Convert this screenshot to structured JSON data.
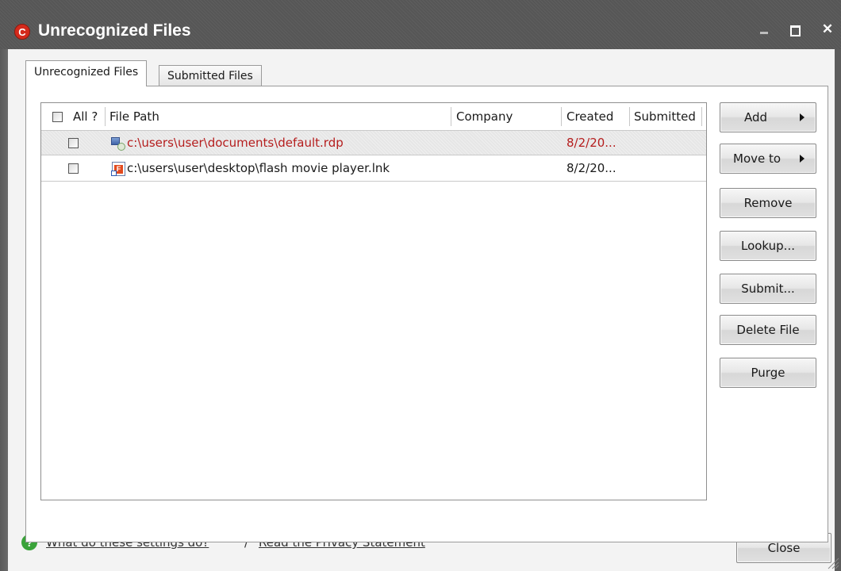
{
  "window": {
    "title": "Unrecognized Files",
    "app_icon_letter": "C"
  },
  "tabs": [
    {
      "label": "Unrecognized Files",
      "active": true
    },
    {
      "label": "Submitted Files",
      "active": false
    }
  ],
  "table": {
    "columns": {
      "all": "All ?",
      "file_path": "File Path",
      "company": "Company",
      "created": "Created",
      "submitted": "Submitted"
    },
    "rows": [
      {
        "file_path": "c:\\users\\user\\documents\\default.rdp",
        "company": "",
        "created": "8/2/20...",
        "submitted": "",
        "selected": true,
        "icon": "rdp-file-icon"
      },
      {
        "file_path": "c:\\users\\user\\desktop\\flash movie player.lnk",
        "company": "",
        "created": "8/2/20...",
        "submitted": "",
        "selected": false,
        "icon": "flash-shortcut-icon"
      }
    ]
  },
  "buttons": {
    "add": "Add",
    "move_to": "Move to",
    "remove": "Remove",
    "lookup": "Lookup...",
    "submit": "Submit...",
    "delete_file": "Delete File",
    "purge": "Purge"
  },
  "footer": {
    "help_link": "What do these settings do?",
    "separator": "/",
    "privacy_link": "Read the Privacy Statement",
    "close": "Close"
  },
  "colors": {
    "selected_row_text": "#b51d1d",
    "titlebar": "#5a5a5a"
  }
}
